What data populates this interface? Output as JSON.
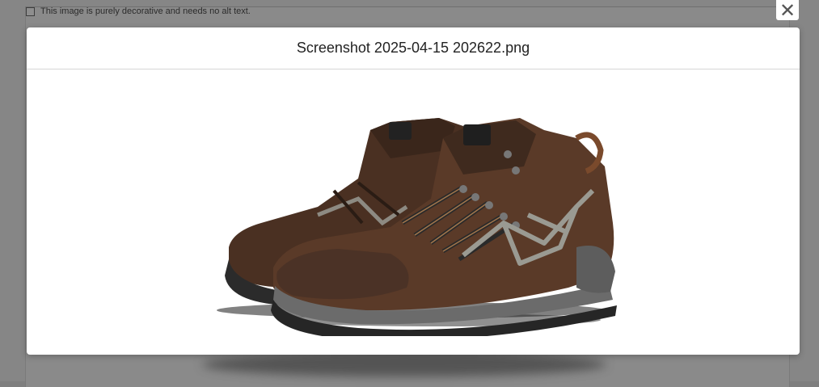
{
  "background_page": {
    "checkbox_label": "This image is purely decorative and needs no alt text."
  },
  "modal": {
    "title": "Screenshot 2025-04-15 202622.png",
    "close_glyph": "✕"
  },
  "image": {
    "subject": "pair of brown hiking boots",
    "colors": {
      "leather": "#5a3a28",
      "sole": "#2e2e2e",
      "accent": "#9a9a92"
    }
  }
}
